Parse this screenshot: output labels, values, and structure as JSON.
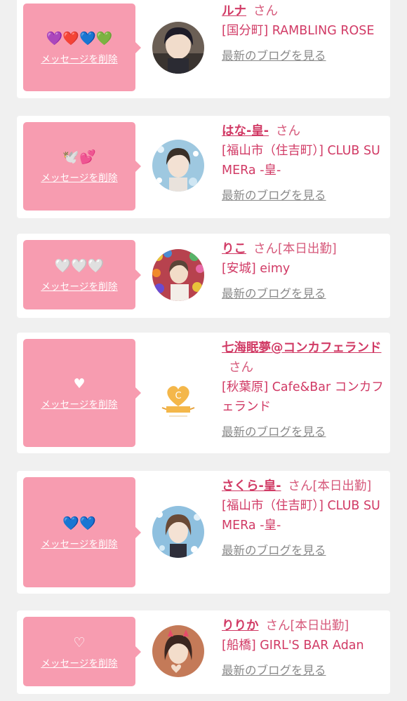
{
  "delete_label": "メッセージを削除",
  "blog_label": "最新のブログを見る",
  "colors": {
    "accent": "#d13a65",
    "bubble": "#f79cb0",
    "link_gray": "#8a8a8a"
  },
  "entries": [
    {
      "emoji": "💜❤️💙💚",
      "name": "ルナ",
      "suffix": "さん",
      "shop": "[国分町] RAMBLING ROSE",
      "avatar": "dark-hair-portrait"
    },
    {
      "emoji": "🕊️💕",
      "name": "はな-皇-",
      "suffix": "さん",
      "shop": "[福山市（住吉町）] CLUB SUMERa -皇-",
      "avatar": "sparkle-portrait"
    },
    {
      "emoji": "🤍🤍🤍",
      "name": "りこ",
      "suffix": "さん[本日出勤]",
      "shop": "[安城] eimy",
      "avatar": "balloon-portrait"
    },
    {
      "emoji": "♥",
      "name": "七海眠夢@コンカフェランド",
      "suffix": "さん",
      "shop": "[秋葉原] Cafe&Bar コンカフェランド",
      "avatar": "cafe-logo"
    },
    {
      "emoji": "💙💙",
      "name": "さくら-皇-",
      "suffix": "さん[本日出勤]",
      "shop": "[福山市（住吉町）] CLUB SUMERa -皇-",
      "avatar": "sparkle-portrait-2"
    },
    {
      "emoji": "♡",
      "name": "りりか",
      "suffix": "さん[本日出勤]",
      "shop": "[船橋] GIRL'S BAR Adan",
      "avatar": "horns-portrait"
    }
  ]
}
